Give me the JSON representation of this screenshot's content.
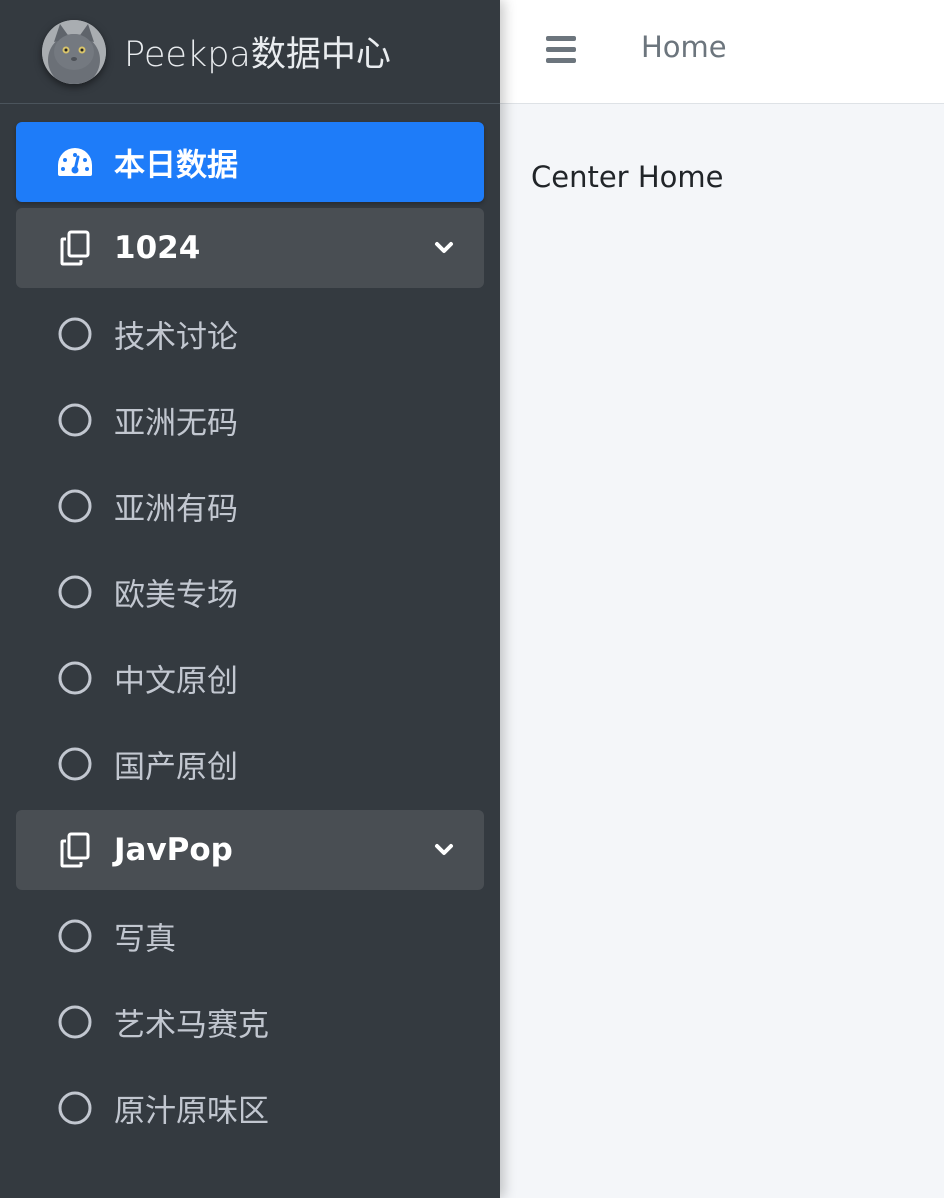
{
  "brand": {
    "title": "Peekpa数据中心",
    "avatar_icon": "cat-avatar"
  },
  "navbar": {
    "menu_icon": "hamburger-icon",
    "home_link": "Home"
  },
  "content": {
    "title": "Center Home"
  },
  "sidebar": {
    "items": [
      {
        "label": "本日数据",
        "icon": "dashboard-gauge-icon",
        "state": "active"
      },
      {
        "label": "1024",
        "icon": "copy-files-icon",
        "state": "open",
        "chevron": "chevron-down"
      },
      {
        "label": "技术讨论",
        "icon": "circle-outline-icon"
      },
      {
        "label": "亚洲无码",
        "icon": "circle-outline-icon"
      },
      {
        "label": "亚洲有码",
        "icon": "circle-outline-icon"
      },
      {
        "label": "欧美专场",
        "icon": "circle-outline-icon"
      },
      {
        "label": "中文原创",
        "icon": "circle-outline-icon"
      },
      {
        "label": "国产原创",
        "icon": "circle-outline-icon"
      },
      {
        "label": "JavPop",
        "icon": "copy-files-icon",
        "state": "open",
        "chevron": "chevron-down"
      },
      {
        "label": "写真",
        "icon": "circle-outline-icon"
      },
      {
        "label": "艺术马赛克",
        "icon": "circle-outline-icon"
      },
      {
        "label": "原汁原味区",
        "icon": "circle-outline-icon"
      }
    ]
  },
  "colors": {
    "sidebar_bg": "#343a40",
    "active_bg": "#1e7cf9",
    "open_group_bg": "#494e53",
    "content_bg": "#f4f6f9"
  }
}
